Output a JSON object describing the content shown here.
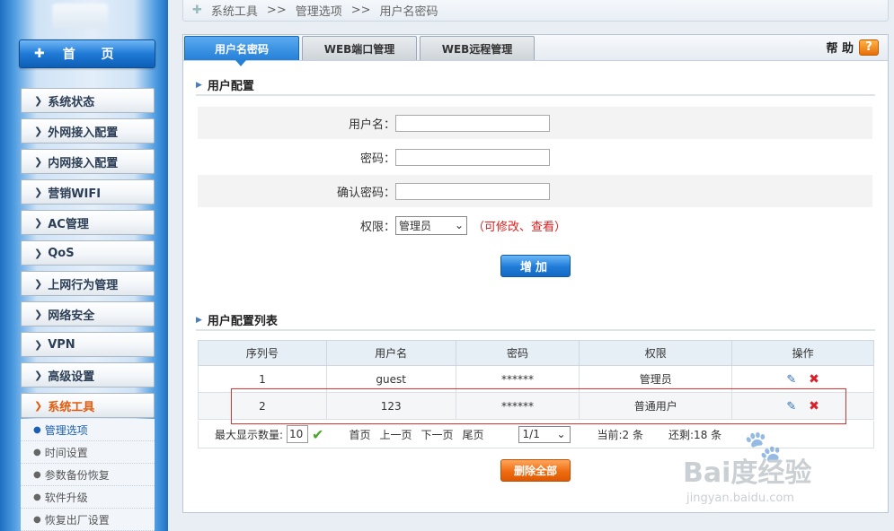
{
  "breadcrumb": {
    "items": [
      "系统工具",
      "管理选项",
      "用户名密码"
    ],
    "sep": ">>"
  },
  "sidebar": {
    "home_label": "首 页",
    "items": [
      {
        "label": "系统状态"
      },
      {
        "label": "外网接入配置"
      },
      {
        "label": "内网接入配置"
      },
      {
        "label": "营销WIFI"
      },
      {
        "label": "AC管理"
      },
      {
        "label": "QoS"
      },
      {
        "label": "上网行为管理"
      },
      {
        "label": "网络安全"
      },
      {
        "label": "VPN"
      },
      {
        "label": "高级设置"
      },
      {
        "label": "系统工具",
        "active": true
      }
    ],
    "subitems": [
      {
        "label": "管理选项",
        "active": true
      },
      {
        "label": "时间设置"
      },
      {
        "label": "参数备份恢复"
      },
      {
        "label": "软件升级"
      },
      {
        "label": "恢复出厂设置"
      }
    ]
  },
  "tabs": [
    {
      "label": "用户名密码",
      "active": true
    },
    {
      "label": "WEB端口管理"
    },
    {
      "label": "WEB远程管理"
    }
  ],
  "help_label": "帮 助",
  "help_icon": "?",
  "user_config": {
    "title": "用户配置",
    "username_label": "用户名",
    "password_label": "密码",
    "confirm_label": "确认密码",
    "permission_label": "权限",
    "colon": "：",
    "permission_value": "管理员",
    "permission_hint": "（可修改、查看）",
    "add_button": "增加"
  },
  "user_list": {
    "title": "用户配置列表",
    "columns": [
      "序列号",
      "用户名",
      "密码",
      "权限",
      "操作"
    ],
    "rows": [
      {
        "index": "1",
        "username": "guest",
        "password": "******",
        "permission": "管理员"
      },
      {
        "index": "2",
        "username": "123",
        "password": "******",
        "permission": "普通用户"
      }
    ],
    "max_display_label": "最大显示数量:",
    "max_display_value": "10",
    "first_page": "首页",
    "prev_page": "上一页",
    "next_page": "下一页",
    "last_page": "尾页",
    "page_select": "1/1",
    "current_count": "当前:2 条",
    "remaining_count": "还剩:18 条",
    "delete_all_button": "删除全部"
  },
  "watermark": {
    "brand": "Bai度经验",
    "url": "jingyan.baidu.com"
  },
  "colors": {
    "accent_blue": "#2580d8",
    "orange": "#f06c10",
    "highlight_red": "#e23030",
    "hint_red": "#e02020"
  }
}
